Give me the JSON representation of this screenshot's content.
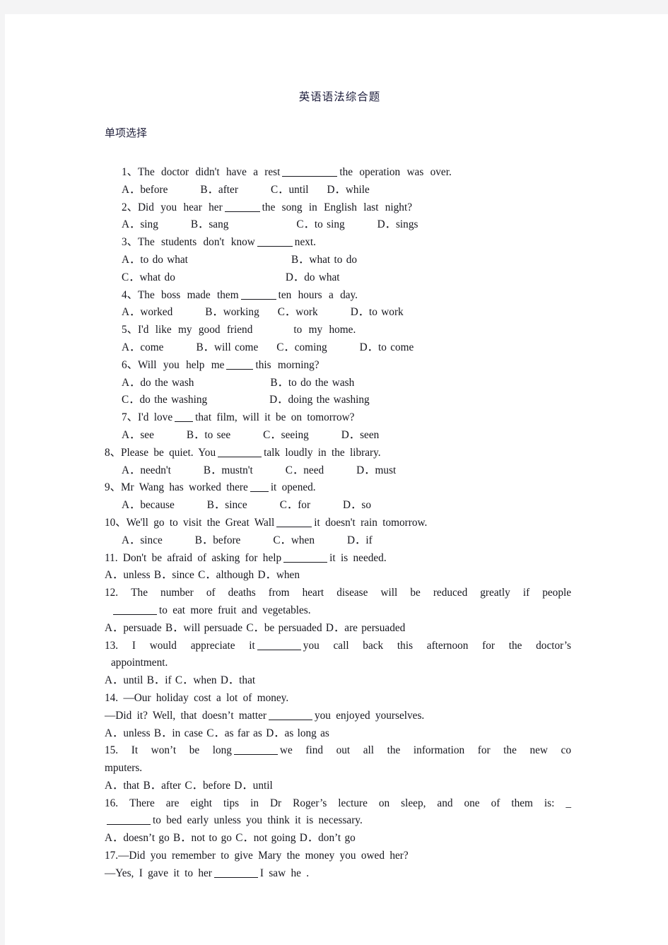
{
  "document": {
    "title": "英语语法综合题",
    "section_label": "单项选择"
  },
  "questions": [
    {
      "number": "1、",
      "stem_pre": "The doctor didn't have a rest",
      "stem_post": "the operation was over.",
      "options_line_1": "A．before",
      "options_line_1b": "B．after",
      "options_line_1c": "C．until",
      "options_line_1d": "D．while"
    },
    {
      "number": "2、",
      "stem_pre": "Did you hear her",
      "stem_post": "the song in English last night?",
      "options_line_1": "A．sing",
      "options_line_1b": "B．sang",
      "options_line_1c": "C．to sing",
      "options_line_1d": "D．sings"
    },
    {
      "number": "3、",
      "stem_pre": "The students don't know",
      "stem_post": "next.",
      "opt_a": "A．to do what",
      "opt_b": "B．what to do",
      "opt_c": "C．what do",
      "opt_d": "D．do what"
    },
    {
      "number": "4、",
      "stem_pre": "The boss made them",
      "stem_post": "ten hours a day.",
      "options_line_1": "A．worked",
      "options_line_1b": "B．working",
      "options_line_1c": "C．work",
      "options_line_1d": "D．to work"
    },
    {
      "number": "5、",
      "stem_pre": "I'd like my good friend",
      "stem_post": "to my home.",
      "options_line_1": "A．come",
      "options_line_1b": "B．will come",
      "options_line_1c": "C．coming",
      "options_line_1d": "D．to come"
    },
    {
      "number": "6、",
      "stem_pre": "Will you help me",
      "stem_post": "this morning?",
      "opt_a": "A．do the wash",
      "opt_b": "B．to do the wash",
      "opt_c": "C．do the washing",
      "opt_d": "D．doing the washing"
    },
    {
      "number": "7、",
      "stem_pre": "I'd love",
      "stem_post": "that film, will it be on tomorrow?",
      "options_line_1": "A．see",
      "options_line_1b": "B．to see",
      "options_line_1c": "C．seeing",
      "options_line_1d": "D．seen"
    },
    {
      "number": "8、",
      "stem_pre": "Please be quiet. You",
      "stem_post": "talk loudly in the library.",
      "options_line_1": "A．needn't",
      "options_line_1b": "B．mustn't",
      "options_line_1c": "C．need",
      "options_line_1d": "D．must"
    },
    {
      "number": "9、",
      "stem_pre": "Mr Wang has worked there",
      "stem_post": "it opened.",
      "options_line_1": "A．because",
      "options_line_1b": "B．since",
      "options_line_1c": "C．for",
      "options_line_1d": "D．so"
    },
    {
      "number": "10、",
      "stem_pre": "We'll go to visit the Great Wall",
      "stem_post": "it doesn't rain tomorrow.",
      "options_line_1": "A．since",
      "options_line_1b": "B．before",
      "options_line_1c": "C．when",
      "options_line_1d": "D．if"
    },
    {
      "number": "11.",
      "stem_pre": "Don't be afraid of asking for help",
      "stem_post": "it is needed.",
      "options_flat": "A．unless  B．since  C．although D．when"
    },
    {
      "number": "12.",
      "stem_line1": "The number of deaths from heart disease will be reduced greatly if people",
      "stem_line2_post": "to eat more fruit and vegetables.",
      "options_flat": "A．persuade  B．will persuade  C．be persuaded  D．are persuaded"
    },
    {
      "number": "13.",
      "stem_pre": "I would appreciate it",
      "stem_mid": "you call back this afternoon for the doctor’s",
      "stem_line2": "appointment.",
      "options_flat": "A．until B．if  C．when D．that"
    },
    {
      "number": "14.",
      "stem_line1": "—Our holiday cost a lot of money.",
      "stem_line2_pre": "—Did it? Well, that doesn’t matter",
      "stem_line2_post": "you enjoyed yourselves.",
      "options_flat": "A．unless  B．in case  C．as far as  D．as long as"
    },
    {
      "number": "15.",
      "stem_pre": "It won’t be long",
      "stem_post": "we find out all the information for the new co",
      "stem_line2": "mputers.",
      "options_flat": "A．that B．after  C．before D．until"
    },
    {
      "number": "16.",
      "stem_line1": "There are eight tips in Dr Roger’s lecture on sleep, and one of them is:",
      "stem_line1_tail": "_",
      "stem_line2_post": "to bed early unless you think it is necessary.",
      "options_flat": "A．doesn’t go B．not to go  C．not going  D．don’t go"
    },
    {
      "number": "17.",
      "stem_line1": "—Did you remember to give Mary the money you owed her?",
      "stem_line2_pre": "—Yes, I gave it to her",
      "stem_line2_post": "I saw he ."
    }
  ]
}
